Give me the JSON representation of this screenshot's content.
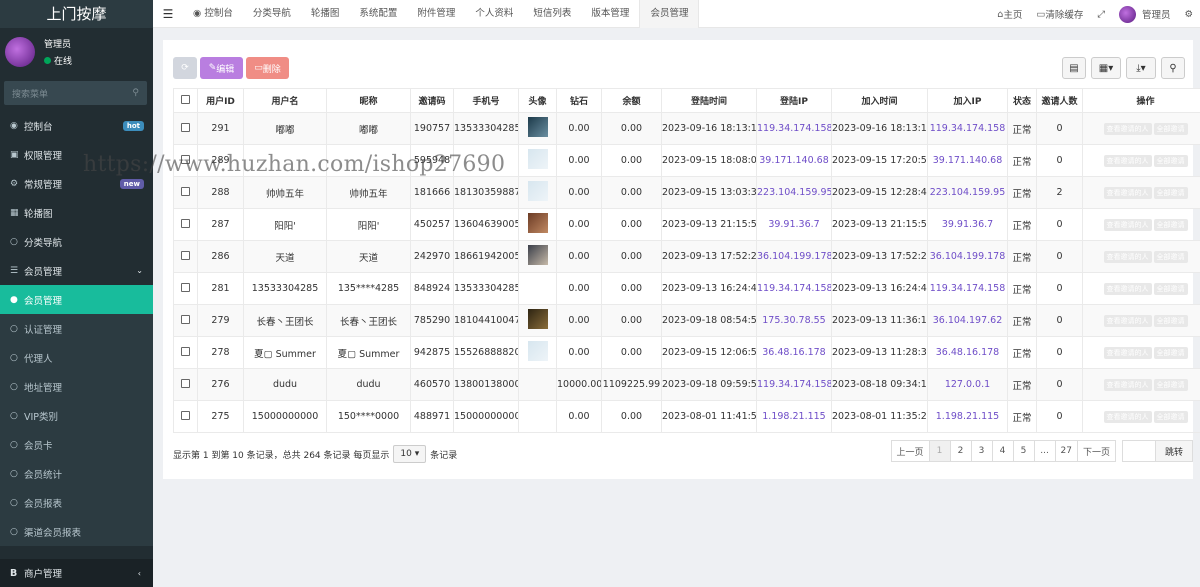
{
  "app": {
    "logo": "上门按摩"
  },
  "sidebar": {
    "user": {
      "name": "管理员",
      "status": "在线"
    },
    "search_placeholder": "搜索菜单",
    "items": [
      {
        "label": "控制台",
        "badge": "hot"
      },
      {
        "label": "权限管理"
      },
      {
        "label": "常规管理",
        "badge": "new"
      },
      {
        "label": "轮播图"
      },
      {
        "label": "分类导航"
      },
      {
        "label": "会员管理"
      },
      {
        "label": "会员管理"
      },
      {
        "label": "认证管理"
      },
      {
        "label": "代理人"
      },
      {
        "label": "地址管理"
      },
      {
        "label": "VIP类别"
      },
      {
        "label": "会员卡"
      },
      {
        "label": "会员统计"
      },
      {
        "label": "会员报表"
      },
      {
        "label": "渠道会员报表"
      }
    ],
    "footer": "商户管理"
  },
  "topbar": {
    "tabs": [
      "控制台",
      "分类导航",
      "轮播图",
      "系统配置",
      "附件管理",
      "个人资料",
      "短信列表",
      "版本管理",
      "会员管理"
    ],
    "home": "主页",
    "clear_cache": "清除缓存",
    "admin": "管理员"
  },
  "toolbar": {
    "edit": "编辑",
    "delete": "删除"
  },
  "table": {
    "headers": [
      "用户ID",
      "用户名",
      "昵称",
      "邀请码",
      "手机号",
      "头像",
      "钻石",
      "余额",
      "登陆时间",
      "登陆IP",
      "加入时间",
      "加入IP",
      "状态",
      "邀请人数",
      "操作"
    ],
    "actions": [
      "查看邀请的人",
      "全部邀请"
    ],
    "rows": [
      {
        "id": "291",
        "username": "嘟嘟",
        "nickname": "嘟嘟",
        "code": "190757",
        "phone": "13533304285",
        "diamond": "0.00",
        "balance": "0.00",
        "login_time": "2023-09-16 18:13:16",
        "login_ip": "119.34.174.158",
        "join_time": "2023-09-16 18:13:16",
        "join_ip": "119.34.174.158",
        "status": "正常",
        "invites": "0"
      },
      {
        "id": "289",
        "username": "",
        "nickname": "",
        "code": "595948",
        "phone": "",
        "diamond": "0.00",
        "balance": "0.00",
        "login_time": "2023-09-15 18:08:08",
        "login_ip": "39.171.140.68",
        "join_time": "2023-09-15 17:20:58",
        "join_ip": "39.171.140.68",
        "status": "正常",
        "invites": "0"
      },
      {
        "id": "288",
        "username": "帅帅五年",
        "nickname": "帅帅五年",
        "code": "181666",
        "phone": "18130359887",
        "diamond": "0.00",
        "balance": "0.00",
        "login_time": "2023-09-15 13:03:36",
        "login_ip": "223.104.159.95",
        "join_time": "2023-09-15 12:28:47",
        "join_ip": "223.104.159.95",
        "status": "正常",
        "invites": "2"
      },
      {
        "id": "287",
        "username": "阳阳'",
        "nickname": "阳阳'",
        "code": "450257",
        "phone": "13604639005",
        "diamond": "0.00",
        "balance": "0.00",
        "login_time": "2023-09-13 21:15:52",
        "login_ip": "39.91.36.7",
        "join_time": "2023-09-13 21:15:52",
        "join_ip": "39.91.36.7",
        "status": "正常",
        "invites": "0"
      },
      {
        "id": "286",
        "username": "天道",
        "nickname": "天道",
        "code": "242970",
        "phone": "18661942005",
        "diamond": "0.00",
        "balance": "0.00",
        "login_time": "2023-09-13 17:52:24",
        "login_ip": "36.104.199.178",
        "join_time": "2023-09-13 17:52:24",
        "join_ip": "36.104.199.178",
        "status": "正常",
        "invites": "0"
      },
      {
        "id": "281",
        "username": "13533304285",
        "nickname": "135****4285",
        "code": "848924",
        "phone": "13533304285",
        "diamond": "0.00",
        "balance": "0.00",
        "login_time": "2023-09-13 16:24:46",
        "login_ip": "119.34.174.158",
        "join_time": "2023-09-13 16:24:46",
        "join_ip": "119.34.174.158",
        "status": "正常",
        "invites": "0"
      },
      {
        "id": "279",
        "username": "长春丶王团长",
        "nickname": "长春丶王团长",
        "code": "785290",
        "phone": "18104410047",
        "diamond": "0.00",
        "balance": "0.00",
        "login_time": "2023-09-18 08:54:56",
        "login_ip": "175.30.78.55",
        "join_time": "2023-09-13 11:36:16",
        "join_ip": "36.104.197.62",
        "status": "正常",
        "invites": "0"
      },
      {
        "id": "278",
        "username": "夏▢ Summer",
        "nickname": "夏▢ Summer",
        "code": "942875",
        "phone": "15526888820",
        "diamond": "0.00",
        "balance": "0.00",
        "login_time": "2023-09-15 12:06:53",
        "login_ip": "36.48.16.178",
        "join_time": "2023-09-13 11:28:31",
        "join_ip": "36.48.16.178",
        "status": "正常",
        "invites": "0"
      },
      {
        "id": "276",
        "username": "dudu",
        "nickname": "dudu",
        "code": "460570",
        "phone": "13800138000",
        "diamond": "10000.00",
        "balance": "1109225.99",
        "login_time": "2023-09-18 09:59:53",
        "login_ip": "119.34.174.158",
        "join_time": "2023-08-18 09:34:16",
        "join_ip": "127.0.0.1",
        "status": "正常",
        "invites": "0"
      },
      {
        "id": "275",
        "username": "15000000000",
        "nickname": "150****0000",
        "code": "488971",
        "phone": "15000000000",
        "diamond": "0.00",
        "balance": "0.00",
        "login_time": "2023-08-01 11:41:56",
        "login_ip": "1.198.21.115",
        "join_time": "2023-08-01 11:35:27",
        "join_ip": "1.198.21.115",
        "status": "正常",
        "invites": "0"
      }
    ]
  },
  "footer": {
    "summary": "显示第 1 到第 10 条记录，总共 264 条记录 每页显示",
    "page_size": "10",
    "suffix": "条记录"
  },
  "pagination": {
    "prev": "上一页",
    "pages": [
      "1",
      "2",
      "3",
      "4",
      "5",
      "...",
      "27"
    ],
    "next": "下一页",
    "jump": "跳转"
  },
  "watermark": "https://www.huzhan.com/ishop27690"
}
